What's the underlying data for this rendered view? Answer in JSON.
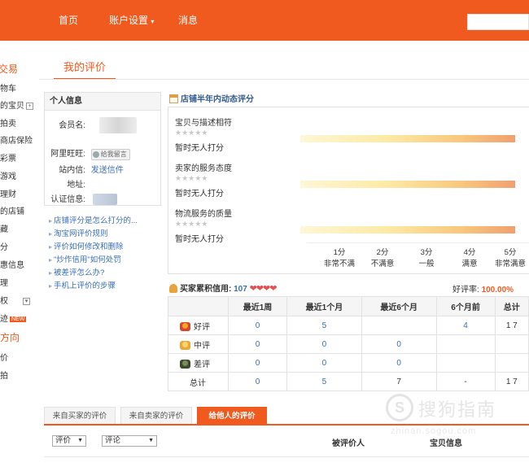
{
  "topnav": {
    "home": "首页",
    "account_settings": "账户设置",
    "messages": "消息"
  },
  "sidebar": {
    "items": [
      "交易",
      "物车",
      "的宝贝",
      "拍卖",
      "商店保险",
      "彩票",
      "游戏",
      "理财",
      "的店铺",
      "藏",
      "分",
      "惠信息",
      "理",
      "权",
      "迹",
      "方向",
      "价",
      "拍"
    ],
    "new_badge": "NEW"
  },
  "main_tab": "我的评价",
  "personal_info": {
    "header": "个人信息",
    "member_label": "会员名:",
    "wangwang_label": "阿里旺旺:",
    "wangwang_button": "给我留言",
    "station_label": "站内信:",
    "station_link": "发送信件",
    "address_label": "地址:",
    "auth_label": "认证信息:"
  },
  "help_links": [
    "店铺评分是怎么打分的...",
    "淘宝网评价规则",
    "评价如何修改和删除",
    "\"炒作信用\"如何处罚",
    "被差评怎么办?",
    "手机上评价的步骤"
  ],
  "rating": {
    "title": "店铺半年内动态评分",
    "items": [
      {
        "label": "宝贝与描述相符",
        "status": "暂时无人打分"
      },
      {
        "label": "卖家的服务态度",
        "status": "暂时无人打分"
      },
      {
        "label": "物流服务的质量",
        "status": "暂时无人打分"
      }
    ],
    "stars": "★★★★★",
    "scale": [
      {
        "score": "1分",
        "desc": "非常不满"
      },
      {
        "score": "2分",
        "desc": "不满意"
      },
      {
        "score": "3分",
        "desc": "一般"
      },
      {
        "score": "4分",
        "desc": "满意"
      },
      {
        "score": "5分",
        "desc": "非常满意"
      }
    ]
  },
  "credit": {
    "label": "买家累积信用:",
    "value": "107",
    "hearts": "❤❤❤❤",
    "good_rate_label": "好评率:",
    "good_rate_value": "100.00%"
  },
  "stats": {
    "headers": [
      "",
      "最近1周",
      "最近1个月",
      "最近6个月",
      "6个月前",
      "总计"
    ],
    "rows": [
      {
        "label": "好评",
        "values": [
          "0",
          "5",
          "",
          "4",
          "1 7"
        ]
      },
      {
        "label": "中评",
        "values": [
          "0",
          "0",
          "0",
          "",
          ""
        ]
      },
      {
        "label": "差评",
        "values": [
          "0",
          "0",
          "0",
          "",
          ""
        ]
      },
      {
        "label": "总计",
        "values": [
          "0",
          "5",
          "7",
          "-",
          "1 7"
        ]
      }
    ]
  },
  "bottom_tabs": {
    "from_buyer": "来自买家的评价",
    "from_seller": "来自卖家的评价",
    "to_others": "给他人的评价"
  },
  "filters": {
    "rating_select": "评价",
    "comment_select": "评论",
    "col_rated_person": "被评价人",
    "col_item_info": "宝贝信息"
  },
  "watermark": {
    "logo_char": "S",
    "text": "搜狗指南",
    "subtext": "zhinan.sogou.com"
  },
  "colors": {
    "accent": "#f15a1e",
    "link": "#3a6fb4"
  }
}
